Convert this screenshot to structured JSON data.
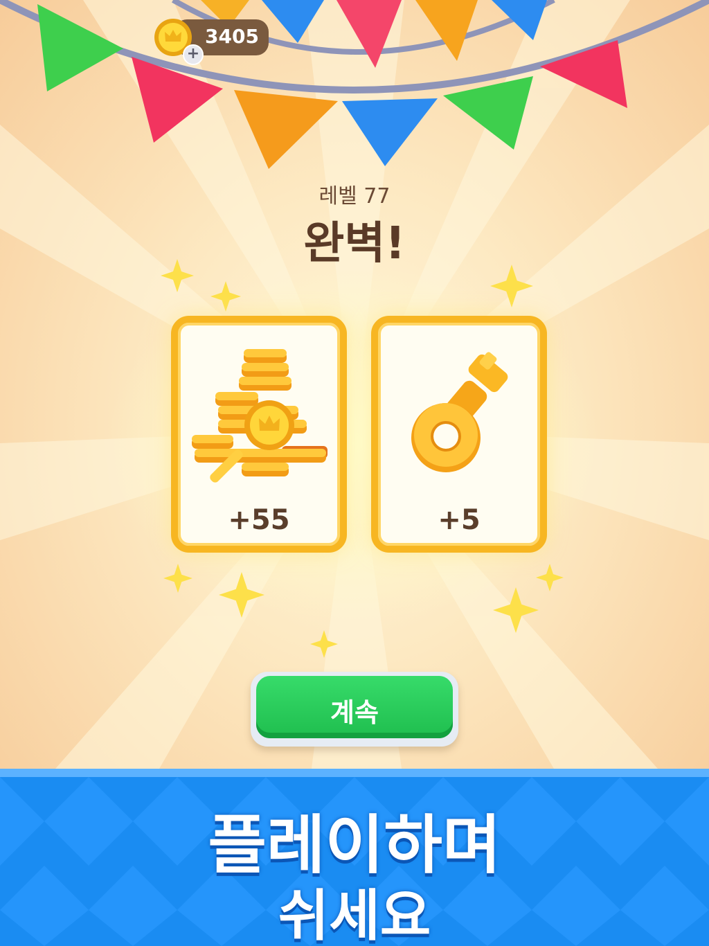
{
  "hud": {
    "coin_balance": "3405",
    "add_coins_symbol": "+",
    "coin_icon": "crown-coin-icon"
  },
  "result": {
    "level_label": "레벨 77",
    "headline": "완벽!"
  },
  "rewards": [
    {
      "name": "coins",
      "icon": "coin-pile-icon",
      "amount": "+55"
    },
    {
      "name": "keys",
      "icon": "key-icon",
      "amount": "+5"
    }
  ],
  "actions": {
    "continue_label": "계속"
  },
  "promo": {
    "line1": "플레이하며",
    "line2": "쉬세요"
  },
  "colors": {
    "card_border": "#f7b622",
    "continue_button": "#28c957",
    "banner": "#1a8cf2",
    "headline_text": "#5a3a27"
  }
}
